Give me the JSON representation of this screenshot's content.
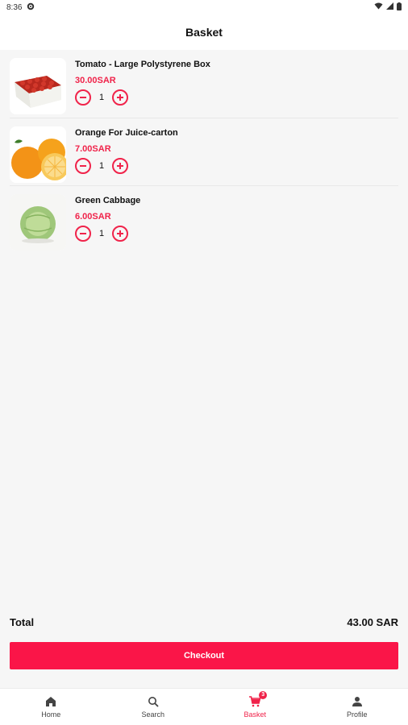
{
  "statusbar": {
    "time": "8:36"
  },
  "header": {
    "title": "Basket"
  },
  "items": [
    {
      "name": "Tomato - Large Polystyrene Box",
      "price": "30.00SAR",
      "qty": "1"
    },
    {
      "name": "Orange For Juice-carton",
      "price": "7.00SAR",
      "qty": "1"
    },
    {
      "name": "Green Cabbage",
      "price": "6.00SAR",
      "qty": "1"
    }
  ],
  "summary": {
    "total_label": "Total",
    "total_value": "43.00 SAR"
  },
  "checkout": {
    "label": "Checkout"
  },
  "nav": {
    "items": [
      {
        "label": "Home",
        "icon": "home-icon"
      },
      {
        "label": "Search",
        "icon": "search-icon"
      },
      {
        "label": "Basket",
        "icon": "cart-icon",
        "badge": "3"
      },
      {
        "label": "Profile",
        "icon": "person-icon"
      }
    ],
    "active": "Basket"
  },
  "colors": {
    "accent": "#f0234a",
    "checkout": "#fa1548",
    "background": "#f6f6f6"
  }
}
